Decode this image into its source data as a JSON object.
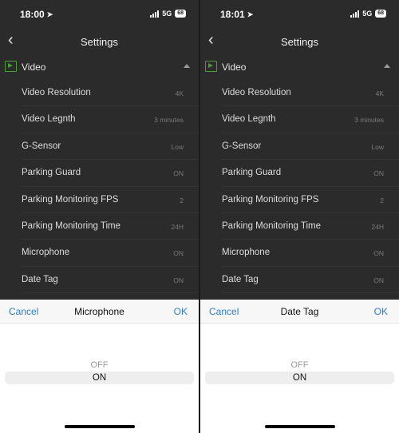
{
  "screens": [
    {
      "status": {
        "time": "18:00",
        "network": "5G",
        "battery": "68"
      },
      "nav": {
        "title": "Settings"
      },
      "section": {
        "label": "Video"
      },
      "rows": [
        {
          "label": "Video Resolution",
          "value": "4K"
        },
        {
          "label": "Video Legnth",
          "value": "3 minutes"
        },
        {
          "label": "G-Sensor",
          "value": "Low"
        },
        {
          "label": "Parking Guard",
          "value": "ON"
        },
        {
          "label": "Parking Monitoring FPS",
          "value": "2"
        },
        {
          "label": "Parking Monitoring Time",
          "value": "24H"
        },
        {
          "label": "Microphone",
          "value": "ON"
        },
        {
          "label": "Date Tag",
          "value": "ON"
        }
      ],
      "picker": {
        "cancel_label": "Cancel",
        "title": "Microphone",
        "ok_label": "OK",
        "options": [
          "OFF",
          "ON"
        ],
        "selected": "ON"
      }
    },
    {
      "status": {
        "time": "18:01",
        "network": "5G",
        "battery": "68"
      },
      "nav": {
        "title": "Settings"
      },
      "section": {
        "label": "Video"
      },
      "rows": [
        {
          "label": "Video Resolution",
          "value": "4K"
        },
        {
          "label": "Video Legnth",
          "value": "3 minutes"
        },
        {
          "label": "G-Sensor",
          "value": "Low"
        },
        {
          "label": "Parking Guard",
          "value": "ON"
        },
        {
          "label": "Parking Monitoring FPS",
          "value": "2"
        },
        {
          "label": "Parking Monitoring Time",
          "value": "24H"
        },
        {
          "label": "Microphone",
          "value": "ON"
        },
        {
          "label": "Date Tag",
          "value": "ON"
        }
      ],
      "picker": {
        "cancel_label": "Cancel",
        "title": "Date Tag",
        "ok_label": "OK",
        "options": [
          "OFF",
          "ON"
        ],
        "selected": "ON"
      }
    }
  ],
  "icons": {
    "back": "chevron-left-icon",
    "location": "location-arrow-icon",
    "signal": "cellular-signal-icon",
    "battery": "battery-icon",
    "section": "video-play-icon",
    "collapse": "caret-up-icon"
  },
  "colors": {
    "accent": "#2f7fd0",
    "video_icon": "#4a9a3a",
    "dark_bg": "#2b2b2b"
  }
}
